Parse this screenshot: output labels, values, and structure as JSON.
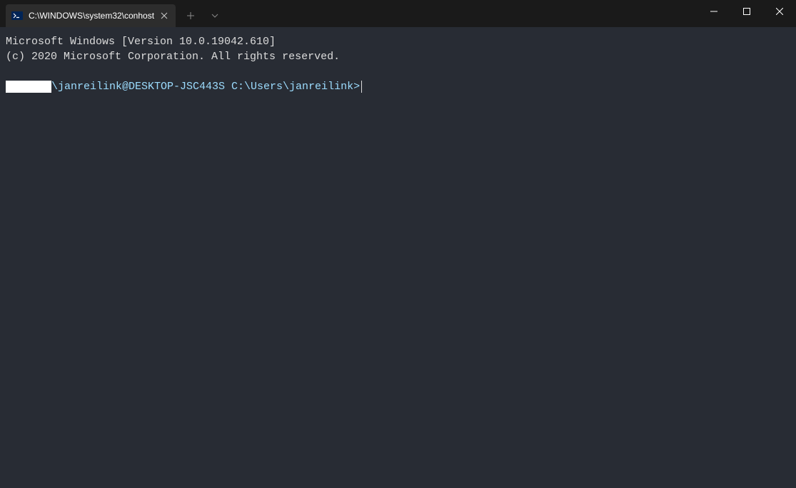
{
  "tab": {
    "title": "C:\\WINDOWS\\system32\\conhost"
  },
  "terminal": {
    "line1": "Microsoft Windows [Version 10.0.19042.610]",
    "line2": "(c) 2020 Microsoft Corporation. All rights reserved.",
    "prompt": "\\janreilink@DESKTOP-JSC443S C:\\Users\\janreilink>"
  }
}
